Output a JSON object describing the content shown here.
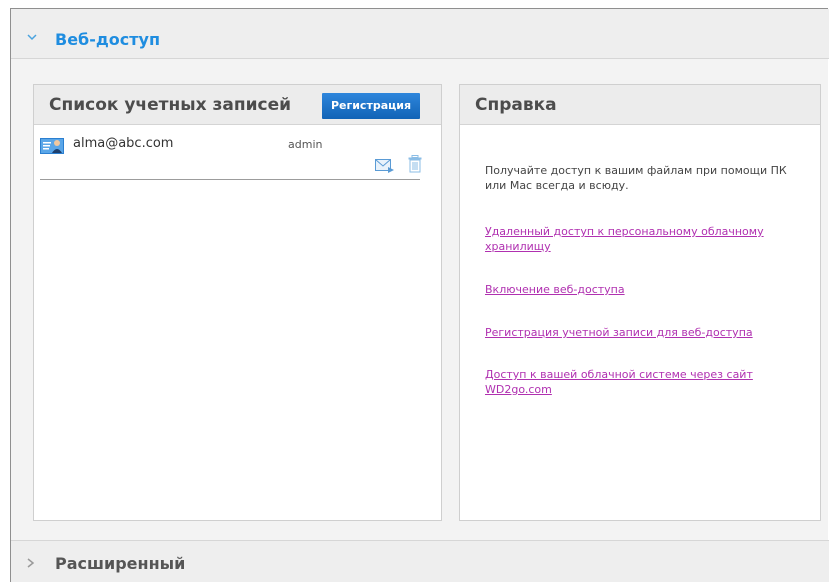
{
  "sections": {
    "web_access": {
      "title": "Веб-доступ",
      "expanded": true
    },
    "advanced": {
      "title": "Расширенный",
      "expanded": false
    }
  },
  "accounts_panel": {
    "title": "Список учетных записей",
    "register_button": "Регистрация",
    "accounts": [
      {
        "email": "alma@abc.com",
        "role": "admin"
      }
    ]
  },
  "help_panel": {
    "title": "Справка",
    "intro": "Получайте доступ к вашим файлам при помощи ПК или Mac всегда и всюду.",
    "links": [
      "Удаленный доступ к персональному облачному хранилищу",
      "Включение веб-доступа",
      "Регистрация учетной записи для веб-доступа",
      "Доступ к вашей облачной системе через сайт WD2go.com"
    ]
  },
  "colors": {
    "accent": "#1f8de0",
    "button": "#1a72c9",
    "link": "#b030b0"
  }
}
